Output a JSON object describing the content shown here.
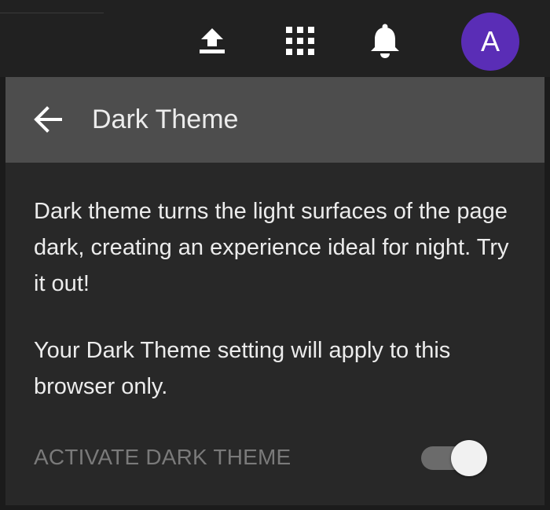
{
  "topbar": {
    "icons": [
      "upload-icon",
      "apps-grid-icon",
      "bell-icon"
    ],
    "avatar_letter": "A",
    "avatar_color": "#5a2db6"
  },
  "panel": {
    "back_icon": "arrow-left-icon",
    "title": "Dark Theme",
    "description": "Dark theme turns the light surfaces of the page dark, creating an experience ideal for night. Try it out!",
    "note": "Your Dark Theme setting will apply to this browser only.",
    "toggle_label": "ACTIVATE DARK THEME",
    "toggle_state": "off"
  }
}
